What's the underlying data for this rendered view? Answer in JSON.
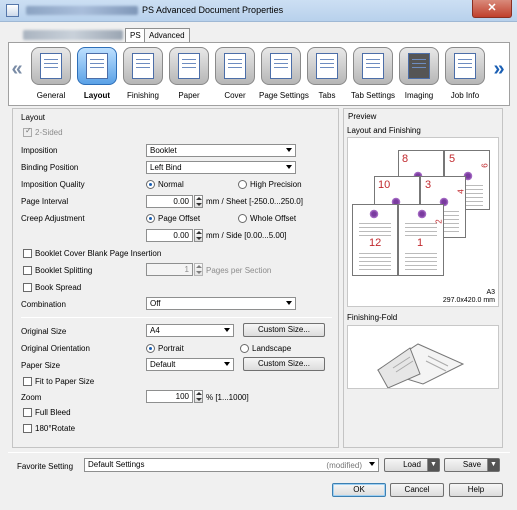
{
  "window": {
    "title": "PS Advanced Document Properties",
    "close_symbol": "✕"
  },
  "top_tabs": [
    {
      "label": "PS",
      "active": true
    },
    {
      "label": "Advanced",
      "active": false
    }
  ],
  "categories": [
    {
      "label": "General",
      "icon": "printer-icon",
      "selected": false
    },
    {
      "label": "Layout",
      "icon": "layout-icon",
      "selected": true
    },
    {
      "label": "Finishing",
      "icon": "finishing-icon",
      "selected": false
    },
    {
      "label": "Paper",
      "icon": "paper-icon",
      "selected": false
    },
    {
      "label": "Cover",
      "icon": "cover-icon",
      "selected": false
    },
    {
      "label": "Page Settings",
      "icon": "page-settings-icon",
      "selected": false
    },
    {
      "label": "Tabs",
      "icon": "tabs-icon",
      "selected": false
    },
    {
      "label": "Tab Settings",
      "icon": "tab-settings-icon",
      "selected": false
    },
    {
      "label": "Imaging",
      "icon": "imaging-icon",
      "selected": false
    },
    {
      "label": "Job Info",
      "icon": "job-info-icon",
      "selected": false
    }
  ],
  "nav": {
    "prev": "«",
    "next": "»"
  },
  "layout": {
    "group_title": "Layout",
    "two_sided": {
      "label": "2-Sided",
      "checked": true,
      "disabled": true
    },
    "imposition": {
      "label": "Imposition",
      "value": "Booklet"
    },
    "binding_position": {
      "label": "Binding Position",
      "value": "Left Bind"
    },
    "imposition_quality": {
      "label": "Imposition Quality",
      "normal": "Normal",
      "high": "High Precision",
      "selected": "Normal"
    },
    "page_interval": {
      "label": "Page Interval",
      "value": "0.00",
      "unit": "mm / Sheet [-250.0...250.0]"
    },
    "creep": {
      "label": "Creep Adjustment",
      "page_offset": "Page Offset",
      "whole_offset": "Whole Offset",
      "selected": "Page Offset",
      "value": "0.00",
      "unit": "mm / Side [0.00...5.00]"
    },
    "booklet_cover_blank": {
      "label": "Booklet Cover Blank Page Insertion",
      "checked": false
    },
    "booklet_splitting": {
      "label": "Booklet Splitting",
      "checked": false,
      "value": "1",
      "unit": "Pages per Section"
    },
    "book_spread": {
      "label": "Book Spread",
      "checked": false
    },
    "combination": {
      "label": "Combination",
      "value": "Off"
    },
    "original_size": {
      "label": "Original Size",
      "value": "A4",
      "button": "Custom Size..."
    },
    "original_orientation": {
      "label": "Original Orientation",
      "portrait": "Portrait",
      "landscape": "Landscape",
      "selected": "Portrait"
    },
    "paper_size": {
      "label": "Paper Size",
      "value": "Default",
      "button": "Custom Size..."
    },
    "fit_to_paper": {
      "label": "Fit to Paper Size",
      "checked": false
    },
    "zoom": {
      "label": "Zoom",
      "value": "100",
      "unit": "% [1...1000]"
    },
    "full_bleed": {
      "label": "Full Bleed",
      "checked": false
    },
    "rotate180": {
      "label": "180°Rotate",
      "checked": false
    }
  },
  "preview": {
    "group_title": "Preview",
    "layout_title": "Layout and Finishing",
    "page_numbers": [
      "8",
      "5",
      "6",
      "10",
      "3",
      "4",
      "12",
      "1",
      "2"
    ],
    "paper_label": "A3",
    "paper_dims": "297.0x420.0 mm",
    "finishing_title": "Finishing-Fold"
  },
  "footer": {
    "favorite_label": "Favorite Setting",
    "favorite_value": "Default Settings",
    "modified": "(modified)",
    "load": "Load",
    "save": "Save",
    "ok": "OK",
    "cancel": "Cancel",
    "help": "Help"
  }
}
